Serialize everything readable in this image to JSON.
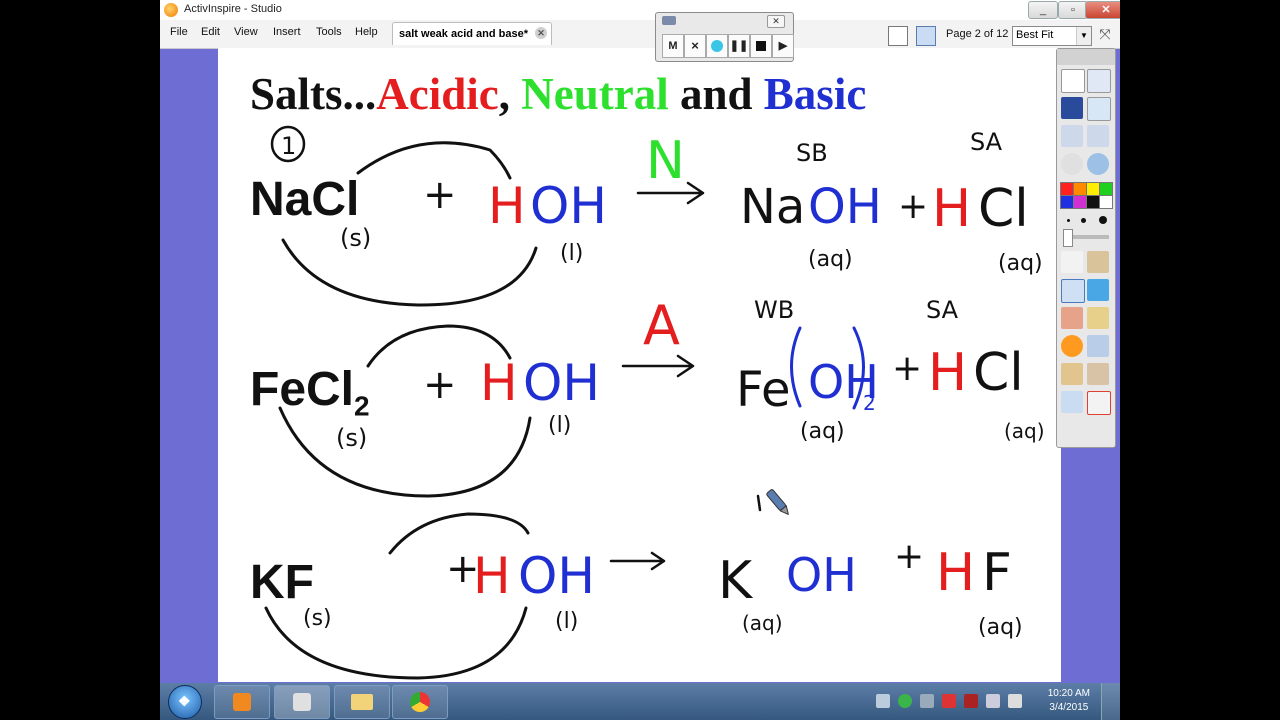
{
  "window": {
    "title": "ActivInspire - Studio"
  },
  "menu": [
    "File",
    "Edit",
    "View",
    "Insert",
    "Tools",
    "Help"
  ],
  "document_tab": {
    "label": "salt weak acid and base*"
  },
  "page_indicator": "Page 2 of 12",
  "zoom": {
    "value": "Best Fit"
  },
  "recorder": {
    "buttons": [
      "M",
      "×"
    ]
  },
  "slide": {
    "title_parts": {
      "part1": "Salts...",
      "acidic": "Acidic",
      "comma": ", ",
      "neutral": "Neutral",
      "and": " and ",
      "basic": "Basic"
    },
    "colors": {
      "acidic": "#e41e1e",
      "neutral": "#2de02d",
      "basic": "#1f2fd1",
      "H_ink": "#e41e1e",
      "OH_ink": "#1f2fd1"
    },
    "reactions": [
      {
        "salt": "NaCl",
        "type_label": "N",
        "circled_number": "1",
        "products": [
          "Na",
          "OH",
          "H",
          "Cl"
        ],
        "labels": [
          "SB",
          "SA"
        ],
        "states": [
          "(s)",
          "(l)",
          "(aq)",
          "(aq)"
        ]
      },
      {
        "salt": "FeCl",
        "salt_sub": "2",
        "type_label": "A",
        "products": [
          "Fe",
          "OH",
          "2",
          "H",
          "Cl"
        ],
        "labels": [
          "WB",
          "SA"
        ],
        "states": [
          "(s)",
          "(l)",
          "(aq)",
          "(aq)"
        ]
      },
      {
        "salt": "KF",
        "type_label": "",
        "products": [
          "K",
          "OH",
          "H",
          "F"
        ],
        "labels": [],
        "states": [
          "(s)",
          "(l)",
          "(aq)",
          "(aq)"
        ]
      }
    ]
  },
  "taskbar": {
    "clock_time": "10:20 AM",
    "clock_date": "3/4/2015"
  }
}
